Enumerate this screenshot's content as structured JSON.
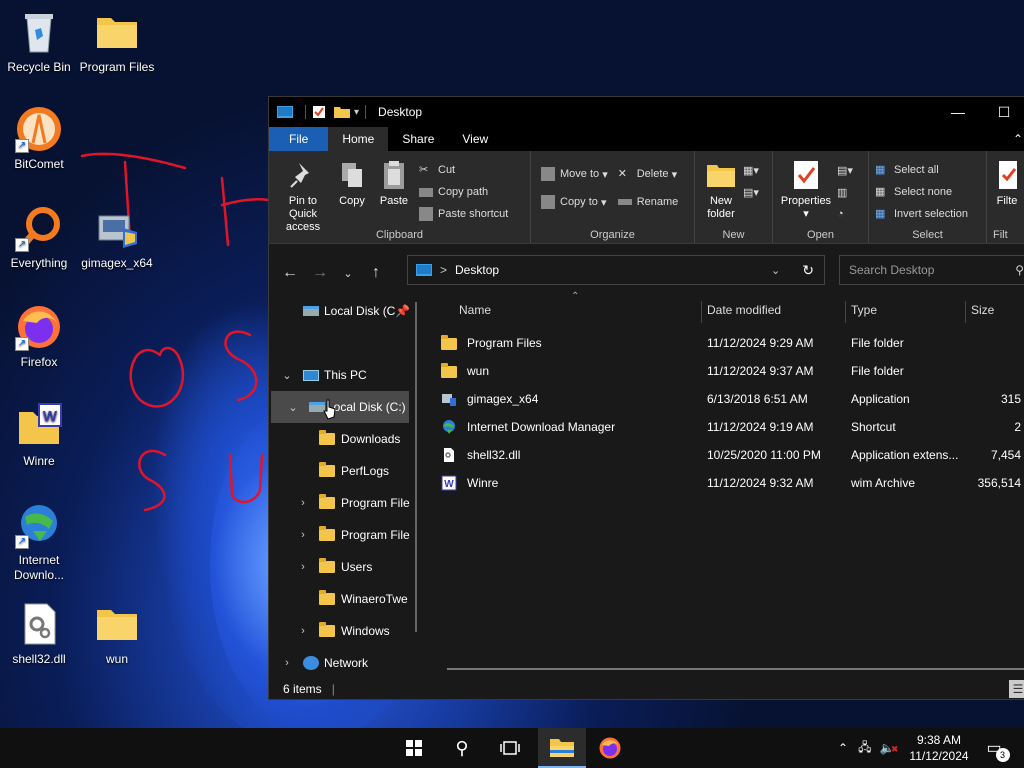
{
  "desktop": {
    "icons": [
      {
        "label": "Recycle Bin"
      },
      {
        "label": "Program Files"
      },
      {
        "label": "BitComet"
      },
      {
        "label": "Everything"
      },
      {
        "label": "gimagex_x64"
      },
      {
        "label": "Firefox"
      },
      {
        "label": "Winre"
      },
      {
        "label": "Internet Downlo..."
      },
      {
        "label": "shell32.dll"
      },
      {
        "label": "wun"
      }
    ]
  },
  "window": {
    "title": "Desktop",
    "controls": {
      "minimize": "—",
      "maximize": "☐"
    },
    "tabs": [
      "File",
      "Home",
      "Share",
      "View"
    ],
    "ribbon": {
      "clipboard": {
        "group_name": "Clipboard",
        "pin": "Pin to Quick access",
        "copy": "Copy",
        "paste": "Paste",
        "cut": "Cut",
        "copy_path": "Copy path",
        "paste_shortcut": "Paste shortcut"
      },
      "organize": {
        "group_name": "Organize",
        "move_to": "Move to",
        "copy_to": "Copy to",
        "delete": "Delete",
        "rename": "Rename"
      },
      "new": {
        "group_name": "New",
        "new_folder": "New folder"
      },
      "open": {
        "group_name": "Open",
        "properties": "Properties"
      },
      "select": {
        "group_name": "Select",
        "select_all": "Select all",
        "select_none": "Select none",
        "invert_selection": "Invert selection"
      },
      "filter": {
        "label": "Filte",
        "group_name": "Filt"
      }
    },
    "address": {
      "path": "Desktop",
      "separator": ">"
    },
    "search": {
      "placeholder": "Search Desktop"
    },
    "nav": {
      "items": [
        {
          "label": "Local Disk (C"
        },
        {
          "label": "This PC"
        },
        {
          "label": "Local Disk (C:)"
        },
        {
          "label": "Downloads"
        },
        {
          "label": "PerfLogs"
        },
        {
          "label": "Program File"
        },
        {
          "label": "Program File"
        },
        {
          "label": "Users"
        },
        {
          "label": "WinaeroTwe"
        },
        {
          "label": "Windows"
        },
        {
          "label": "Network"
        }
      ]
    },
    "columns": {
      "name": "Name",
      "date": "Date modified",
      "type": "Type",
      "size": "Size"
    },
    "files": [
      {
        "name": "Program Files",
        "date": "11/12/2024 9:29 AM",
        "type": "File folder",
        "size": ""
      },
      {
        "name": "wun",
        "date": "11/12/2024 9:37 AM",
        "type": "File folder",
        "size": ""
      },
      {
        "name": "gimagex_x64",
        "date": "6/13/2018 6:51 AM",
        "type": "Application",
        "size": "315"
      },
      {
        "name": "Internet Download Manager",
        "date": "11/12/2024 9:19 AM",
        "type": "Shortcut",
        "size": "2"
      },
      {
        "name": "shell32.dll",
        "date": "10/25/2020 11:00 PM",
        "type": "Application extens...",
        "size": "7,454"
      },
      {
        "name": "Winre",
        "date": "11/12/2024 9:32 AM",
        "type": "wim Archive",
        "size": "356,514"
      }
    ],
    "status": {
      "count": "6 items"
    }
  },
  "taskbar": {
    "time": "9:38 AM",
    "date": "11/12/2024",
    "notifications": "3"
  },
  "colors": {
    "accent": "#1a5fb4",
    "folder": "#f4c54b",
    "selection": "#4a4a4a"
  }
}
